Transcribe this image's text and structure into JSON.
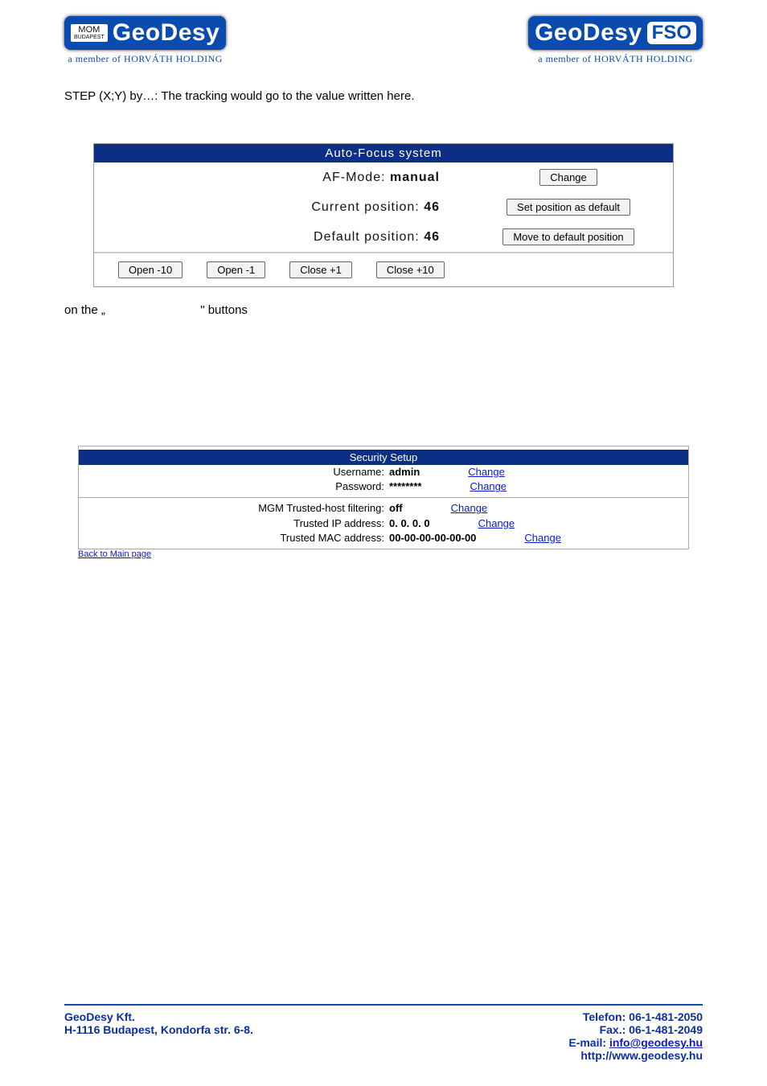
{
  "header": {
    "logo_left": {
      "badge_top": "MOM",
      "badge_bot": "BUDAPEST",
      "name": "GeoDesy",
      "tagline": "a member of HORVÁTH HOLDING"
    },
    "logo_right": {
      "name": "GeoDesy",
      "badge": "FSO",
      "tagline": "a member of HORVÁTH HOLDING"
    }
  },
  "body": {
    "step_line": "STEP (X;Y) by…: The tracking would go to the value written here.",
    "on_the": "on the „",
    "buttons_quote": "\" buttons"
  },
  "af": {
    "title": "Auto-Focus system",
    "mode_label": "AF-Mode: ",
    "mode_value": "manual",
    "change_btn": "Change",
    "cur_label": "Current position: ",
    "cur_value": "46",
    "set_default_btn": "Set position as default",
    "def_label": "Default position: ",
    "def_value": "46",
    "move_default_btn": "Move to default position",
    "open10": "Open -10",
    "open1": "Open -1",
    "close1": "Close +1",
    "close10": "Close +10"
  },
  "sec": {
    "title": "Security Setup",
    "user_label": "Username: ",
    "user_val": "admin",
    "pass_label": "Password: ",
    "pass_val": "********",
    "filter_label": "MGM Trusted-host filtering: ",
    "filter_val": "off",
    "ip_label": "Trusted IP address: ",
    "ip_val": "0. 0. 0. 0",
    "mac_label": "Trusted MAC address: ",
    "mac_val": "00-00-00-00-00-00",
    "change": "Change",
    "back": "Back to Main page"
  },
  "footer": {
    "company": "GeoDesy Kft.",
    "address": "H-1116 Budapest, Kondorfa str. 6-8.",
    "tel": "Telefon: 06-1-481-2050",
    "fax": "Fax.: 06-1-481-2049",
    "email_label": "E-mail: ",
    "email": "info@geodesy.hu",
    "web": "http://www.geodesy.hu"
  }
}
